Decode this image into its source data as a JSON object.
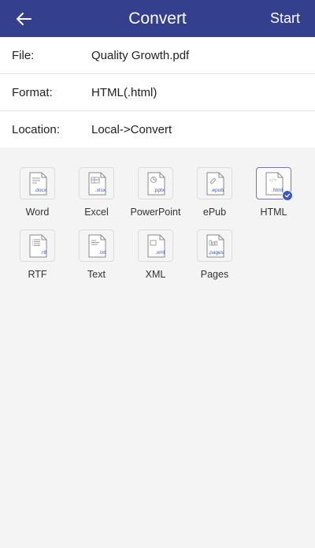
{
  "header": {
    "title": "Convert",
    "start_label": "Start"
  },
  "info": {
    "file_label": "File:",
    "file_value": "Quality Growth.pdf",
    "format_label": "Format:",
    "format_value": "HTML(.html)",
    "location_label": "Location:",
    "location_value": "Local->Convert"
  },
  "formats": [
    {
      "label": "Word",
      "ext": ".docx",
      "glyph": "lines",
      "selected": false
    },
    {
      "label": "Excel",
      "ext": ".xlsx",
      "glyph": "table",
      "selected": false
    },
    {
      "label": "PowerPoint",
      "ext": ".pptx",
      "glyph": "pie",
      "selected": false
    },
    {
      "label": "ePub",
      "ext": ".epub",
      "glyph": "pen",
      "selected": false
    },
    {
      "label": "HTML",
      "ext": ".html",
      "glyph": "code",
      "selected": true
    },
    {
      "label": "RTF",
      "ext": ".rtf",
      "glyph": "list",
      "selected": false
    },
    {
      "label": "Text",
      "ext": ".txt",
      "glyph": "lines2",
      "selected": false
    },
    {
      "label": "XML",
      "ext": ".xml",
      "glyph": "rect",
      "selected": false
    },
    {
      "label": "Pages",
      "ext": ".pages",
      "glyph": "bars",
      "selected": false
    }
  ],
  "colors": {
    "header_bg": "#34408d",
    "accent": "#3b57c9"
  }
}
